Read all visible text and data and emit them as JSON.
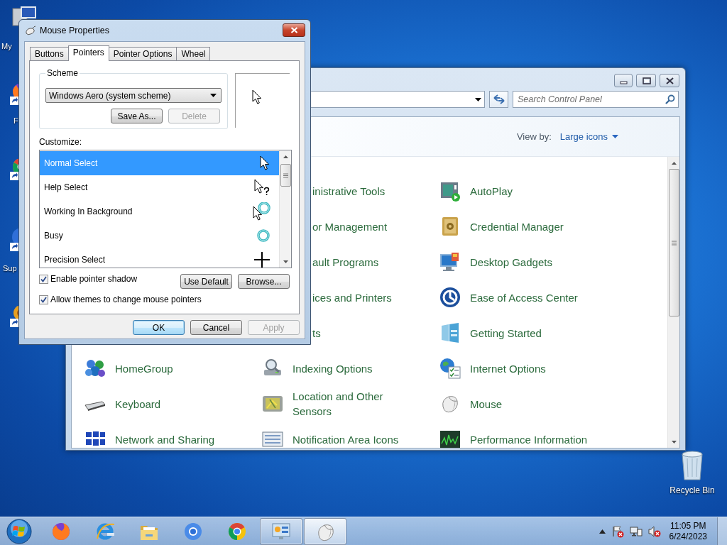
{
  "desktop_icons": [
    {
      "kind": "computer",
      "lines": [
        "My"
      ]
    },
    {
      "kind": "firefox",
      "lines": [
        "F"
      ]
    },
    {
      "kind": "chrome"
    },
    {
      "kind": "support",
      "lines": [
        "Sup"
      ]
    },
    {
      "kind": "folder"
    }
  ],
  "recycle_bin": {
    "label": "Recycle Bin"
  },
  "control_panel": {
    "search": {
      "placeholder": "Search Control Panel"
    },
    "view_by": {
      "label": "View by:",
      "value": "Large icons"
    },
    "rows": [
      {
        "items": [
          {
            "label": "inistrative Tools",
            "kind": "cut"
          },
          {
            "label": "AutoPlay",
            "kind": "autoplay"
          }
        ]
      },
      {
        "items": [
          {
            "label": "or Management",
            "kind": "cut"
          },
          {
            "label": "Credential Manager",
            "kind": "safe"
          }
        ]
      },
      {
        "items": [
          {
            "label": "ault Programs",
            "kind": "cut"
          },
          {
            "label": "Desktop Gadgets",
            "kind": "gadgets"
          }
        ]
      },
      {
        "items": [
          {
            "label": "ices and Printers",
            "kind": "cut"
          },
          {
            "label": "Ease of Access Center",
            "kind": "access"
          }
        ]
      },
      {
        "items": [
          {
            "label": "ts",
            "kind": "cut"
          },
          {
            "label": "Getting Started",
            "kind": "started"
          }
        ]
      },
      {
        "items": [
          {
            "label": "HomeGroup",
            "kind": "homegroup"
          },
          {
            "label": "Indexing Options",
            "kind": "indexing"
          },
          {
            "label": "Internet Options",
            "kind": "internet"
          }
        ]
      },
      {
        "items": [
          {
            "label": "Keyboard",
            "kind": "keyboard"
          },
          {
            "label": "Location and Other Sensors",
            "kind": "location"
          },
          {
            "label": "Mouse",
            "kind": "mouse"
          }
        ]
      },
      {
        "items": [
          {
            "label": "Network and Sharing",
            "kind": "network"
          },
          {
            "label": "Notification Area Icons",
            "kind": "notification"
          },
          {
            "label": "Performance Information",
            "kind": "performance"
          }
        ]
      }
    ]
  },
  "dialog": {
    "title": "Mouse Properties",
    "tabs": [
      {
        "label": "Buttons",
        "selected": false
      },
      {
        "label": "Pointers",
        "selected": true
      },
      {
        "label": "Pointer Options",
        "selected": false
      },
      {
        "label": "Wheel",
        "selected": false
      }
    ],
    "scheme": {
      "label": "Scheme",
      "value": "Windows Aero (system scheme)",
      "buttons": [
        {
          "label": "Save As...",
          "disabled": false
        },
        {
          "label": "Delete",
          "disabled": true
        }
      ]
    },
    "customize_label": "Customize:",
    "pointers": [
      {
        "name": "Normal Select",
        "selected": true,
        "kind": "arrow"
      },
      {
        "name": "Help Select",
        "selected": false,
        "kind": "help"
      },
      {
        "name": "Working In Background",
        "selected": false,
        "kind": "working"
      },
      {
        "name": "Busy",
        "selected": false,
        "kind": "busy"
      },
      {
        "name": "Precision Select",
        "selected": false,
        "kind": "precision"
      }
    ],
    "options": [
      {
        "label": "Enable pointer shadow",
        "checked": true
      },
      {
        "label": "Allow themes to change mouse pointers",
        "checked": true
      }
    ],
    "list_buttons": [
      {
        "label": "Use Default",
        "disabled": false
      },
      {
        "label": "Browse...",
        "disabled": false
      }
    ],
    "buttons": [
      {
        "label": "OK",
        "disabled": false,
        "default": true
      },
      {
        "label": "Cancel",
        "disabled": false,
        "default": false
      },
      {
        "label": "Apply",
        "disabled": true,
        "default": false
      }
    ]
  },
  "taskbar": {
    "apps": [
      {
        "kind": "firefox",
        "running": false,
        "selected": false
      },
      {
        "kind": "ie",
        "running": false,
        "selected": false
      },
      {
        "kind": "explorer",
        "running": false,
        "selected": false
      },
      {
        "kind": "chromium",
        "running": false,
        "selected": false
      },
      {
        "kind": "chrome",
        "running": false,
        "selected": false
      },
      {
        "kind": "cpanel",
        "running": true,
        "selected": false
      },
      {
        "kind": "mouse",
        "running": true,
        "selected": true
      }
    ],
    "clock": {
      "time": "11:05 PM",
      "date": "6/24/2023"
    }
  }
}
